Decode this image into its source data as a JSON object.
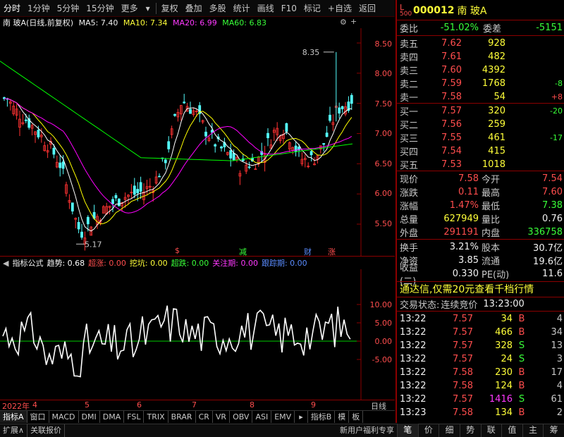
{
  "toolbar": {
    "items": [
      "分时",
      "1分钟",
      "5分钟",
      "15分钟",
      "更多",
      "复权",
      "叠加",
      "多股",
      "统计",
      "画线",
      "F10",
      "标记",
      "+自选",
      "返回"
    ]
  },
  "chart": {
    "title": "南 玻A(日线,前复权)",
    "ma5": "MA5: 7.40",
    "ma10": "MA10: 7.34",
    "ma20": "MA20: 6.99",
    "ma60": "MA60: 6.83",
    "colors": {
      "ma5": "#ffffff",
      "ma10": "#ffff00",
      "ma20": "#ff00ff",
      "ma60": "#00ff00",
      "up": "#ff3232",
      "down": "#54ffff",
      "ind": "#ffffff",
      "zero": "#00cc00"
    },
    "high_marker": "8.35",
    "low_marker": "5.17",
    "signals": [
      "$",
      "减",
      "财",
      "涨"
    ],
    "price_axis": [
      "8.50",
      "8.00",
      "7.50",
      "7.00",
      "6.50",
      "6.00",
      "5.50"
    ],
    "ind_axis": [
      "10.00",
      "5.00",
      "0.00",
      "-5.00"
    ]
  },
  "indicator": {
    "name": "指标公式",
    "values": [
      {
        "label": "趋势: 0.68",
        "color": "#ffffff"
      },
      {
        "label": "超涨: 0.00",
        "color": "#ff4d4d"
      },
      {
        "label": "挖坑: 0.00",
        "color": "#ffff39"
      },
      {
        "label": "超跌: 0.00",
        "color": "#39ff39"
      },
      {
        "label": "关注期: 0.00",
        "color": "#ff39ff"
      },
      {
        "label": "跟踪期: 0.00",
        "color": "#5a8cff"
      }
    ]
  },
  "date_axis": [
    "2022年",
    "4",
    "5",
    "6",
    "7",
    "8",
    "9"
  ],
  "date_axis_right": "日线",
  "ind_tabs": [
    "指标A",
    "窗口",
    "MACD",
    "DMI",
    "DMA",
    "FSL",
    "TRIX",
    "BRAR",
    "CR",
    "VR",
    "OBV",
    "ASI",
    "EMV",
    "指标B",
    "模",
    "板"
  ],
  "status_bar": {
    "left": [
      "扩展∧",
      "关联报价"
    ],
    "right_text": "新用户福利专享"
  },
  "right_tabs": [
    "笔",
    "价",
    "细",
    "势",
    "联",
    "值",
    "主",
    "筹"
  ],
  "stock": {
    "code": "000012",
    "name": "南 玻A",
    "badge_top": "L",
    "badge_bottom": "500",
    "weibi_label": "委比",
    "weibi_value": "-51.02%",
    "weicha_label": "委差",
    "weicha_value": "-5151",
    "sell": [
      {
        "label": "卖五",
        "price": "7.62",
        "vol": "928",
        "chg": ""
      },
      {
        "label": "卖四",
        "price": "7.61",
        "vol": "482",
        "chg": ""
      },
      {
        "label": "卖三",
        "price": "7.60",
        "vol": "4392",
        "chg": ""
      },
      {
        "label": "卖二",
        "price": "7.59",
        "vol": "1768",
        "chg": "-8"
      },
      {
        "label": "卖一",
        "price": "7.58",
        "vol": "54",
        "chg": "+8"
      }
    ],
    "buy": [
      {
        "label": "买一",
        "price": "7.57",
        "vol": "320",
        "chg": "-20"
      },
      {
        "label": "买二",
        "price": "7.56",
        "vol": "259",
        "chg": ""
      },
      {
        "label": "买三",
        "price": "7.55",
        "vol": "461",
        "chg": "-17"
      },
      {
        "label": "买四",
        "price": "7.54",
        "vol": "415",
        "chg": ""
      },
      {
        "label": "买五",
        "price": "7.53",
        "vol": "1018",
        "chg": ""
      }
    ],
    "quote": [
      {
        "l1": "现价",
        "v1": "7.58",
        "l2": "今开",
        "v2": "7.54"
      },
      {
        "l1": "涨跌",
        "v1": "0.11",
        "l2": "最高",
        "v2": "7.60"
      },
      {
        "l1": "涨幅",
        "v1": "1.47%",
        "l2": "最低",
        "v2": "7.38"
      },
      {
        "l1": "总量",
        "v1": "627949",
        "l2": "量比",
        "v2": "0.76"
      },
      {
        "l1": "外盘",
        "v1": "291191",
        "l2": "内盘",
        "v2": "336758"
      }
    ],
    "fundamentals": [
      {
        "l1": "换手",
        "v1": "3.21%",
        "l2": "股本",
        "v2": "30.7亿"
      },
      {
        "l1": "净资",
        "v1": "3.85",
        "l2": "流通",
        "v2": "19.6亿"
      },
      {
        "l1": "收益(二)",
        "v1": "0.330",
        "l2": "PE(动)",
        "v2": "11.6"
      }
    ],
    "promo": "通达信,仅需20元查看千档行情",
    "trade_status_label": "交易状态:",
    "trade_status_value": "连续竞价",
    "trade_status_time": "13:23:00",
    "ticks": [
      {
        "time": "13:22",
        "price": "7.57",
        "vol": "34",
        "bs": "B",
        "n": "4"
      },
      {
        "time": "13:22",
        "price": "7.57",
        "vol": "466",
        "bs": "B",
        "n": "34"
      },
      {
        "time": "13:22",
        "price": "7.57",
        "vol": "328",
        "bs": "S",
        "n": "13"
      },
      {
        "time": "13:22",
        "price": "7.57",
        "vol": "24",
        "bs": "S",
        "n": "3"
      },
      {
        "time": "13:22",
        "price": "7.58",
        "vol": "230",
        "bs": "B",
        "n": "17"
      },
      {
        "time": "13:22",
        "price": "7.58",
        "vol": "124",
        "bs": "B",
        "n": "4"
      },
      {
        "time": "13:22",
        "price": "7.57",
        "vol": "1416",
        "bs": "S",
        "n": "61"
      },
      {
        "time": "13:23",
        "price": "7.58",
        "vol": "134",
        "bs": "B",
        "n": "2"
      }
    ]
  }
}
